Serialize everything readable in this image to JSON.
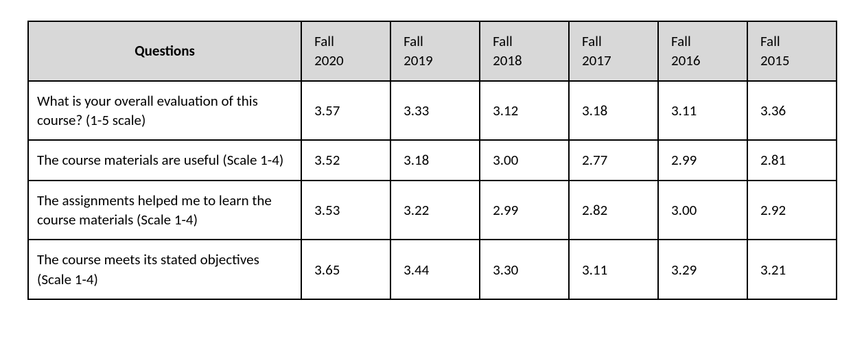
{
  "chart_data": {
    "type": "table",
    "title": "",
    "columns": [
      "Questions",
      "Fall 2020",
      "Fall 2019",
      "Fall 2018",
      "Fall 2017",
      "Fall 2016",
      "Fall 2015"
    ],
    "rows": [
      {
        "question": "What is your overall evaluation of this course? (1-5 scale)",
        "values": [
          3.57,
          3.33,
          3.12,
          3.18,
          3.11,
          3.36
        ]
      },
      {
        "question": "The course materials are useful (Scale 1-4)",
        "values": [
          3.52,
          3.18,
          3.0,
          2.77,
          2.99,
          2.81
        ]
      },
      {
        "question": "The assignments helped me to learn the course materials (Scale 1-4)",
        "values": [
          3.53,
          3.22,
          2.99,
          2.82,
          3.0,
          2.92
        ]
      },
      {
        "question": "The course meets its stated objectives (Scale 1-4)",
        "values": [
          3.65,
          3.44,
          3.3,
          3.11,
          3.29,
          3.21
        ]
      }
    ]
  },
  "table": {
    "headers": {
      "questions": "Questions",
      "year0_line1": "Fall",
      "year0_line2": "2020",
      "year1_line1": "Fall",
      "year1_line2": "2019",
      "year2_line1": "Fall",
      "year2_line2": "2018",
      "year3_line1": "Fall",
      "year3_line2": "2017",
      "year4_line1": "Fall",
      "year4_line2": "2016",
      "year5_line1": "Fall",
      "year5_line2": "2015"
    },
    "rows": {
      "r0": {
        "q": "What is your overall evaluation of this course? (1-5 scale)",
        "v0": "3.57",
        "v1": "3.33",
        "v2": "3.12",
        "v3": "3.18",
        "v4": "3.11",
        "v5": "3.36"
      },
      "r1": {
        "q": "The course materials are useful (Scale 1-4)",
        "v0": "3.52",
        "v1": "3.18",
        "v2": "3.00",
        "v3": "2.77",
        "v4": "2.99",
        "v5": "2.81"
      },
      "r2": {
        "q": "The assignments helped me to learn the course materials (Scale 1-4)",
        "v0": "3.53",
        "v1": "3.22",
        "v2": "2.99",
        "v3": "2.82",
        "v4": "3.00",
        "v5": "2.92"
      },
      "r3": {
        "q": "The course meets its stated objectives (Scale 1-4)",
        "v0": "3.65",
        "v1": "3.44",
        "v2": "3.30",
        "v3": "3.11",
        "v4": "3.29",
        "v5": "3.21"
      }
    }
  }
}
